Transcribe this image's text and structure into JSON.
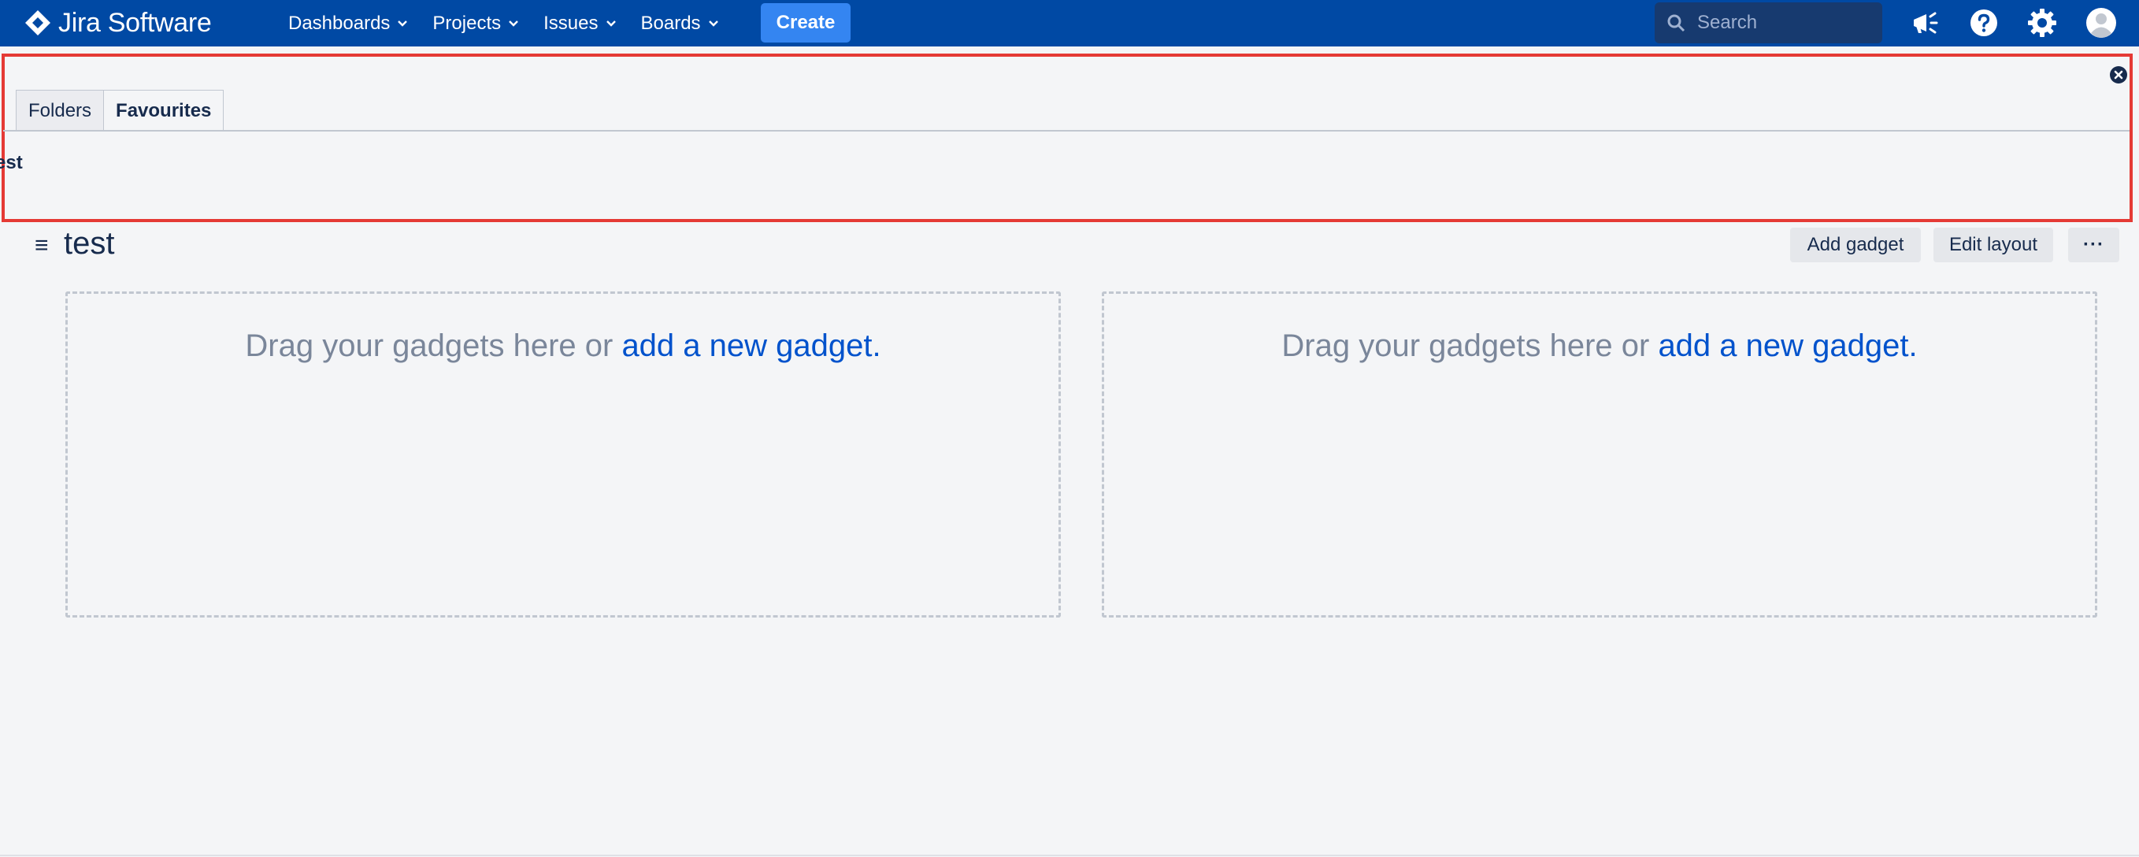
{
  "app": {
    "logo_text": "Jira Software"
  },
  "nav": {
    "items": [
      {
        "label": "Dashboards"
      },
      {
        "label": "Projects"
      },
      {
        "label": "Issues"
      },
      {
        "label": "Boards"
      }
    ],
    "create_label": "Create",
    "search_placeholder": "Search",
    "icons": [
      "notifications-icon",
      "help-icon",
      "settings-icon",
      "avatar-icon"
    ]
  },
  "favourites_panel": {
    "tabs": [
      {
        "label": "Folders",
        "active": false
      },
      {
        "label": "Favourites",
        "active": true
      }
    ],
    "items": [
      {
        "label": "test"
      }
    ]
  },
  "dashboard": {
    "title": "test",
    "actions": {
      "add_gadget": "Add gadget",
      "edit_layout": "Edit layout",
      "more": "···"
    },
    "columns": [
      {
        "prompt": "Drag your gadgets here or ",
        "link": "add a new gadget."
      },
      {
        "prompt": "Drag your gadgets here or ",
        "link": "add a new gadget."
      }
    ]
  },
  "colors": {
    "header_bg": "#0049a4",
    "create_bg": "#3485f1",
    "highlight_border": "#e53a35",
    "link": "#0052cc"
  }
}
